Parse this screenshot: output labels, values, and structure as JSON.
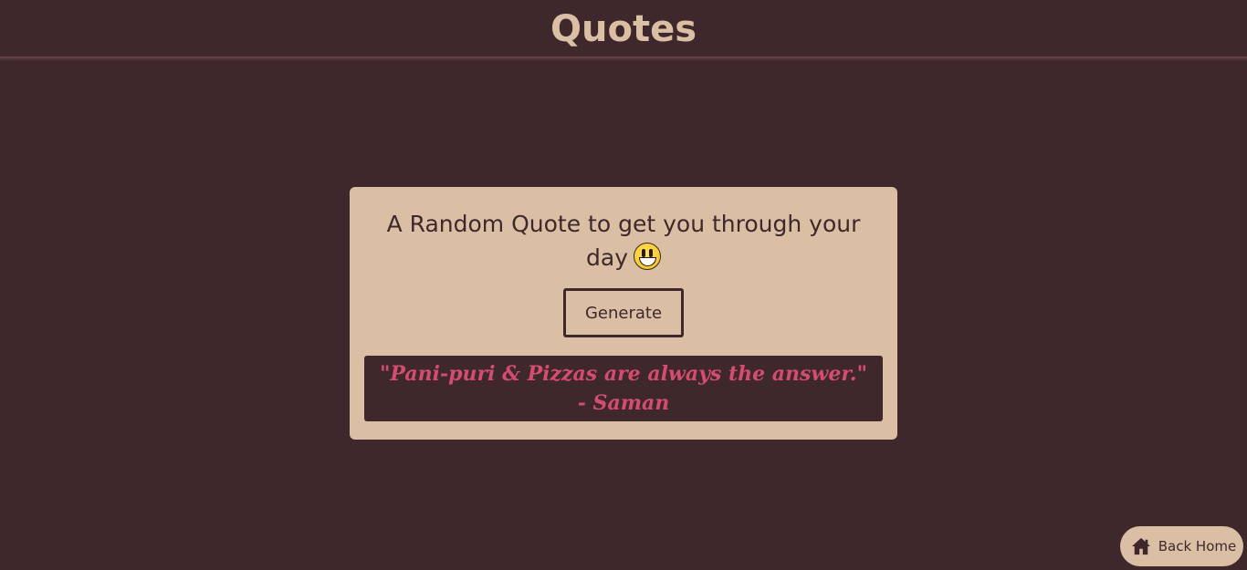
{
  "header": {
    "title": "Quotes"
  },
  "card": {
    "heading": "A Random Quote to get you through your day",
    "emoji_icon": "grinning-face-emoji",
    "generate_label": "Generate",
    "quote": {
      "text": "\"Pani-puri & Pizzas are always the answer.\"",
      "author": "- Saman"
    }
  },
  "back_home": {
    "label": "Back Home",
    "icon": "home-icon"
  },
  "colors": {
    "background": "#3e282b",
    "accent": "#dbbfa4",
    "quote_text": "#d44d70"
  }
}
